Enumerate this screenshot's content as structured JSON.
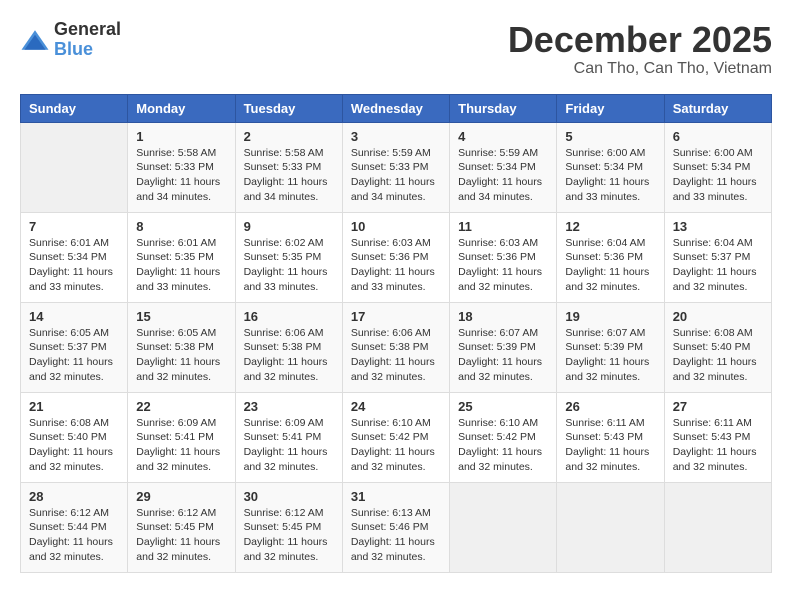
{
  "logo": {
    "general": "General",
    "blue": "Blue"
  },
  "title": "December 2025",
  "subtitle": "Can Tho, Can Tho, Vietnam",
  "headers": [
    "Sunday",
    "Monday",
    "Tuesday",
    "Wednesday",
    "Thursday",
    "Friday",
    "Saturday"
  ],
  "weeks": [
    [
      {
        "day": "",
        "info": ""
      },
      {
        "day": "1",
        "info": "Sunrise: 5:58 AM\nSunset: 5:33 PM\nDaylight: 11 hours\nand 34 minutes."
      },
      {
        "day": "2",
        "info": "Sunrise: 5:58 AM\nSunset: 5:33 PM\nDaylight: 11 hours\nand 34 minutes."
      },
      {
        "day": "3",
        "info": "Sunrise: 5:59 AM\nSunset: 5:33 PM\nDaylight: 11 hours\nand 34 minutes."
      },
      {
        "day": "4",
        "info": "Sunrise: 5:59 AM\nSunset: 5:34 PM\nDaylight: 11 hours\nand 34 minutes."
      },
      {
        "day": "5",
        "info": "Sunrise: 6:00 AM\nSunset: 5:34 PM\nDaylight: 11 hours\nand 33 minutes."
      },
      {
        "day": "6",
        "info": "Sunrise: 6:00 AM\nSunset: 5:34 PM\nDaylight: 11 hours\nand 33 minutes."
      }
    ],
    [
      {
        "day": "7",
        "info": "Sunrise: 6:01 AM\nSunset: 5:34 PM\nDaylight: 11 hours\nand 33 minutes."
      },
      {
        "day": "8",
        "info": "Sunrise: 6:01 AM\nSunset: 5:35 PM\nDaylight: 11 hours\nand 33 minutes."
      },
      {
        "day": "9",
        "info": "Sunrise: 6:02 AM\nSunset: 5:35 PM\nDaylight: 11 hours\nand 33 minutes."
      },
      {
        "day": "10",
        "info": "Sunrise: 6:03 AM\nSunset: 5:36 PM\nDaylight: 11 hours\nand 33 minutes."
      },
      {
        "day": "11",
        "info": "Sunrise: 6:03 AM\nSunset: 5:36 PM\nDaylight: 11 hours\nand 32 minutes."
      },
      {
        "day": "12",
        "info": "Sunrise: 6:04 AM\nSunset: 5:36 PM\nDaylight: 11 hours\nand 32 minutes."
      },
      {
        "day": "13",
        "info": "Sunrise: 6:04 AM\nSunset: 5:37 PM\nDaylight: 11 hours\nand 32 minutes."
      }
    ],
    [
      {
        "day": "14",
        "info": "Sunrise: 6:05 AM\nSunset: 5:37 PM\nDaylight: 11 hours\nand 32 minutes."
      },
      {
        "day": "15",
        "info": "Sunrise: 6:05 AM\nSunset: 5:38 PM\nDaylight: 11 hours\nand 32 minutes."
      },
      {
        "day": "16",
        "info": "Sunrise: 6:06 AM\nSunset: 5:38 PM\nDaylight: 11 hours\nand 32 minutes."
      },
      {
        "day": "17",
        "info": "Sunrise: 6:06 AM\nSunset: 5:38 PM\nDaylight: 11 hours\nand 32 minutes."
      },
      {
        "day": "18",
        "info": "Sunrise: 6:07 AM\nSunset: 5:39 PM\nDaylight: 11 hours\nand 32 minutes."
      },
      {
        "day": "19",
        "info": "Sunrise: 6:07 AM\nSunset: 5:39 PM\nDaylight: 11 hours\nand 32 minutes."
      },
      {
        "day": "20",
        "info": "Sunrise: 6:08 AM\nSunset: 5:40 PM\nDaylight: 11 hours\nand 32 minutes."
      }
    ],
    [
      {
        "day": "21",
        "info": "Sunrise: 6:08 AM\nSunset: 5:40 PM\nDaylight: 11 hours\nand 32 minutes."
      },
      {
        "day": "22",
        "info": "Sunrise: 6:09 AM\nSunset: 5:41 PM\nDaylight: 11 hours\nand 32 minutes."
      },
      {
        "day": "23",
        "info": "Sunrise: 6:09 AM\nSunset: 5:41 PM\nDaylight: 11 hours\nand 32 minutes."
      },
      {
        "day": "24",
        "info": "Sunrise: 6:10 AM\nSunset: 5:42 PM\nDaylight: 11 hours\nand 32 minutes."
      },
      {
        "day": "25",
        "info": "Sunrise: 6:10 AM\nSunset: 5:42 PM\nDaylight: 11 hours\nand 32 minutes."
      },
      {
        "day": "26",
        "info": "Sunrise: 6:11 AM\nSunset: 5:43 PM\nDaylight: 11 hours\nand 32 minutes."
      },
      {
        "day": "27",
        "info": "Sunrise: 6:11 AM\nSunset: 5:43 PM\nDaylight: 11 hours\nand 32 minutes."
      }
    ],
    [
      {
        "day": "28",
        "info": "Sunrise: 6:12 AM\nSunset: 5:44 PM\nDaylight: 11 hours\nand 32 minutes."
      },
      {
        "day": "29",
        "info": "Sunrise: 6:12 AM\nSunset: 5:45 PM\nDaylight: 11 hours\nand 32 minutes."
      },
      {
        "day": "30",
        "info": "Sunrise: 6:12 AM\nSunset: 5:45 PM\nDaylight: 11 hours\nand 32 minutes."
      },
      {
        "day": "31",
        "info": "Sunrise: 6:13 AM\nSunset: 5:46 PM\nDaylight: 11 hours\nand 32 minutes."
      },
      {
        "day": "",
        "info": ""
      },
      {
        "day": "",
        "info": ""
      },
      {
        "day": "",
        "info": ""
      }
    ]
  ]
}
